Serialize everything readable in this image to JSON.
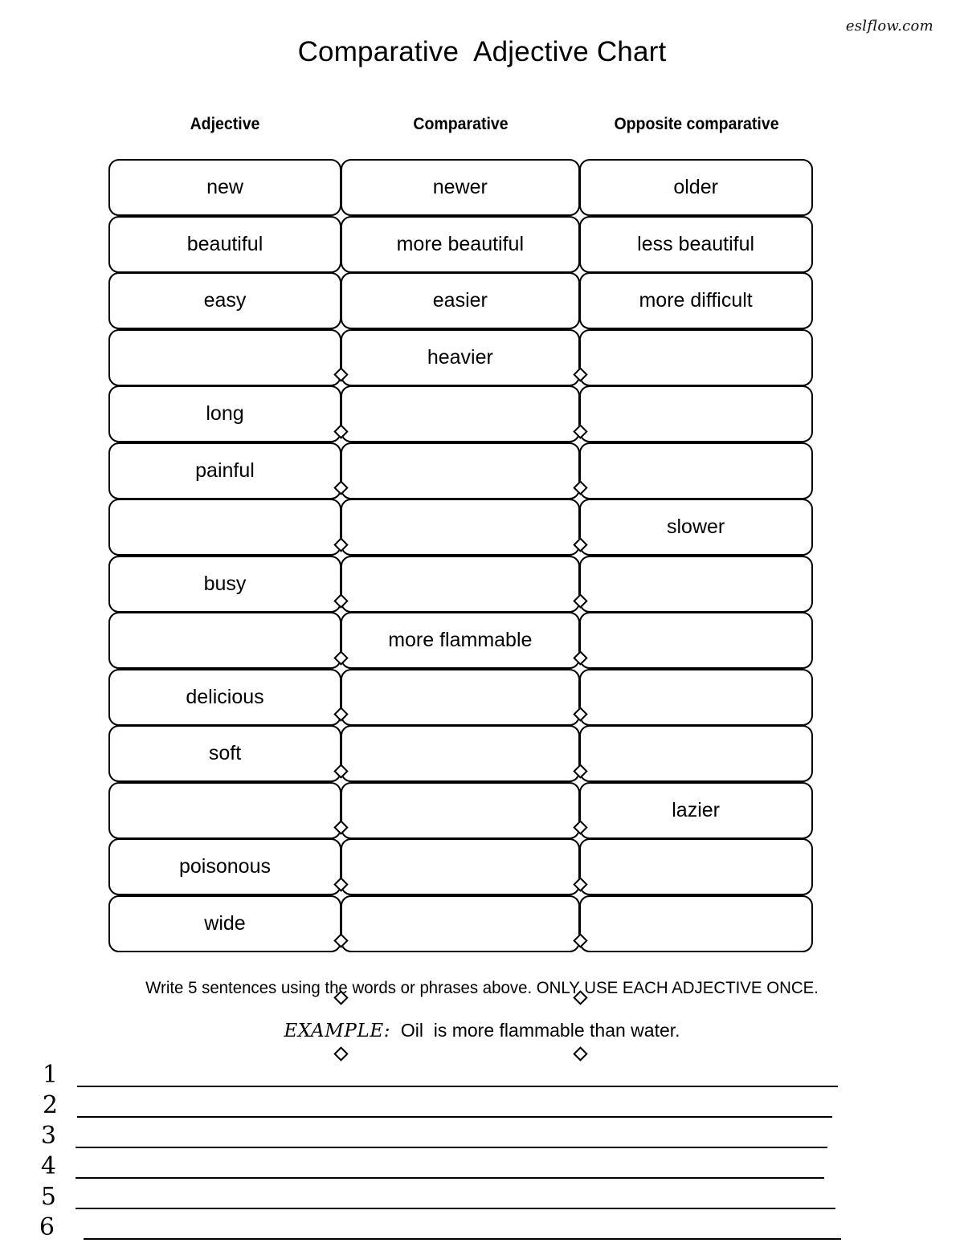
{
  "watermark": "eslflow.com",
  "title": "Comparative  Adjective Chart",
  "headers": {
    "adjective": "Adjective",
    "comparative": "Comparative",
    "opposite": "Opposite comparative"
  },
  "chart_data": {
    "type": "table",
    "title": "Comparative  Adjective Chart",
    "columns": [
      "Adjective",
      "Comparative",
      "Opposite comparative"
    ],
    "rows": [
      {
        "adjective": "new",
        "comparative": "newer",
        "opposite": "older"
      },
      {
        "adjective": "beautiful",
        "comparative": "more beautiful",
        "opposite": "less beautiful"
      },
      {
        "adjective": "easy",
        "comparative": "easier",
        "opposite": "more difficult"
      },
      {
        "adjective": "",
        "comparative": "heavier",
        "opposite": ""
      },
      {
        "adjective": "long",
        "comparative": "",
        "opposite": ""
      },
      {
        "adjective": "painful",
        "comparative": "",
        "opposite": ""
      },
      {
        "adjective": "",
        "comparative": "",
        "opposite": "slower"
      },
      {
        "adjective": "busy",
        "comparative": "",
        "opposite": ""
      },
      {
        "adjective": "",
        "comparative": "more flammable",
        "opposite": ""
      },
      {
        "adjective": "delicious",
        "comparative": "",
        "opposite": ""
      },
      {
        "adjective": "soft",
        "comparative": "",
        "opposite": ""
      },
      {
        "adjective": "",
        "comparative": "",
        "opposite": "lazier"
      },
      {
        "adjective": "poisonous",
        "comparative": "",
        "opposite": ""
      },
      {
        "adjective": "wide",
        "comparative": "",
        "opposite": ""
      }
    ]
  },
  "instruction": "Write 5 sentences using the words or phrases above. ONLY USE EACH ADJECTIVE ONCE.",
  "example": {
    "label": "EXAMPLE:",
    "sentence": "  Oil  is more flammable than water."
  },
  "answer_lines": [
    {
      "number": "1"
    },
    {
      "number": "2"
    },
    {
      "number": "3"
    },
    {
      "number": "4"
    },
    {
      "number": "5"
    },
    {
      "number": "6"
    }
  ],
  "colors": {
    "ink": "#000000",
    "page": "#ffffff"
  }
}
